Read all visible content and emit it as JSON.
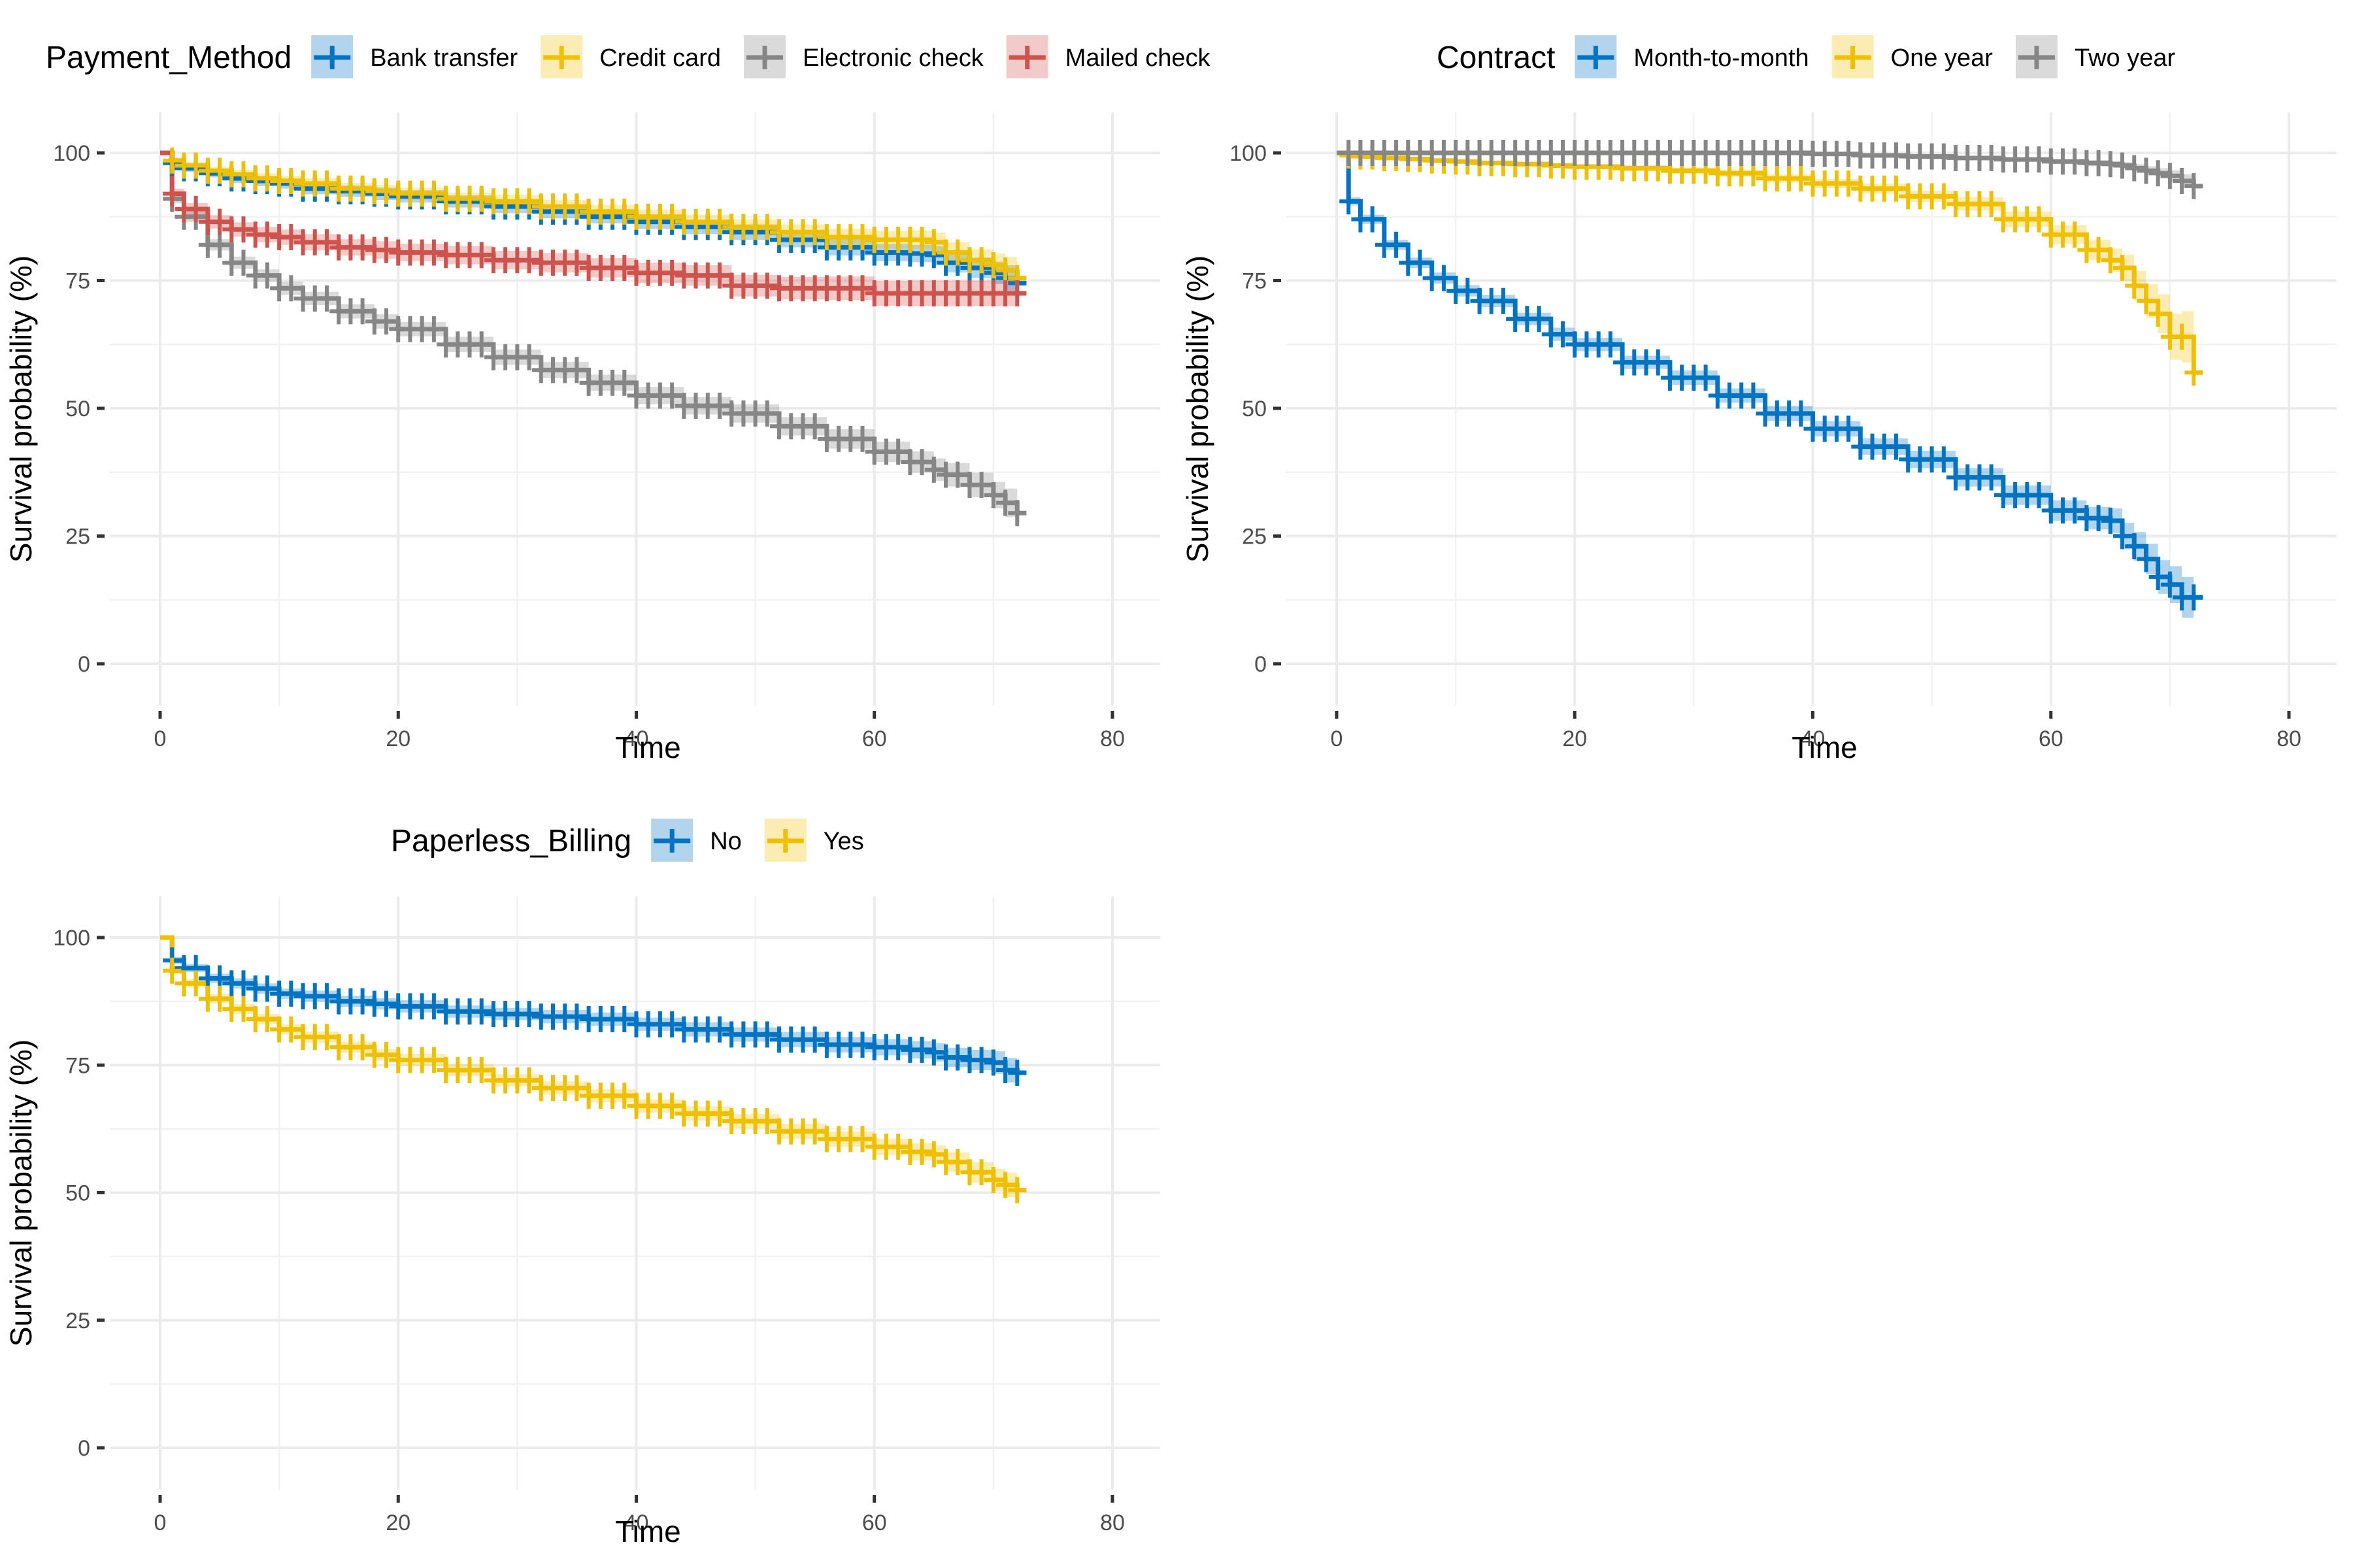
{
  "chart_data": [
    {
      "type": "line",
      "subtype": "kaplan-meier-step",
      "title": "",
      "xlabel": "Time",
      "ylabel": "Survival probability (%)",
      "xlim": [
        0,
        80
      ],
      "ylim": [
        0,
        100
      ],
      "x_ticks": [
        0,
        20,
        40,
        60,
        80
      ],
      "y_ticks": [
        0,
        25,
        50,
        75,
        100
      ],
      "x_tick_labels": [
        "0",
        "20",
        "40",
        "60",
        "80"
      ],
      "y_tick_labels": [
        "0",
        "25",
        "50",
        "75",
        "100"
      ],
      "grid": true,
      "legend_position": "top",
      "legend_title": "Payment_Method",
      "x": [
        0,
        1,
        2,
        4,
        6,
        8,
        10,
        12,
        15,
        18,
        20,
        24,
        28,
        32,
        36,
        40,
        44,
        48,
        52,
        56,
        60,
        63,
        65,
        66,
        68,
        70,
        71,
        72
      ],
      "series": [
        {
          "name": "Bank transfer",
          "color": "#0073C2",
          "values": [
            100,
            98,
            97,
            96,
            95,
            94.5,
            94,
            93,
            92.5,
            92,
            91.5,
            90.5,
            89.5,
            88.5,
            87.5,
            86.5,
            85.5,
            84.5,
            83,
            81.5,
            80.5,
            80.3,
            80,
            78.5,
            77.5,
            76.5,
            75.5,
            74.5
          ],
          "ci_halfwidth": [
            0,
            0.6,
            0.7,
            0.8,
            0.9,
            1.0,
            1.0,
            1.1,
            1.1,
            1.2,
            1.2,
            1.2,
            1.3,
            1.3,
            1.3,
            1.4,
            1.4,
            1.5,
            1.5,
            1.6,
            1.7,
            1.7,
            1.8,
            1.9,
            2.0,
            2.2,
            2.5,
            2.7
          ]
        },
        {
          "name": "Credit card",
          "color": "#EFC000",
          "values": [
            100,
            98.5,
            97.5,
            96.5,
            95.8,
            95,
            94.5,
            94,
            93,
            92.5,
            92,
            91,
            90.5,
            89.5,
            88.5,
            87.5,
            86.5,
            85.5,
            84.5,
            83.5,
            83,
            83,
            82.5,
            80.5,
            79,
            78,
            77,
            75.5
          ],
          "ci_halfwidth": [
            0,
            0.6,
            0.7,
            0.8,
            0.9,
            1.0,
            1.0,
            1.1,
            1.1,
            1.2,
            1.2,
            1.2,
            1.3,
            1.3,
            1.3,
            1.4,
            1.4,
            1.5,
            1.5,
            1.6,
            1.7,
            1.8,
            1.9,
            2.0,
            2.1,
            2.3,
            2.6,
            2.8
          ]
        },
        {
          "name": "Electronic check",
          "color": "#868686",
          "values": [
            100,
            91,
            87.5,
            82,
            78.5,
            76,
            73.5,
            71.5,
            69,
            67,
            65.5,
            62.5,
            60,
            57.5,
            55,
            52.5,
            50.5,
            49,
            46.5,
            44,
            41.5,
            39.5,
            38,
            37,
            35,
            33,
            31.5,
            29.5
          ],
          "ci_halfwidth": [
            0,
            0.9,
            1.0,
            1.1,
            1.2,
            1.2,
            1.3,
            1.3,
            1.4,
            1.4,
            1.4,
            1.5,
            1.5,
            1.6,
            1.6,
            1.7,
            1.7,
            1.8,
            1.8,
            1.9,
            2.0,
            2.1,
            2.2,
            2.3,
            2.4,
            2.6,
            2.8,
            3.0
          ]
        },
        {
          "name": "Mailed check",
          "color": "#CD534C",
          "values": [
            100,
            92,
            89,
            86.5,
            85,
            84,
            83.5,
            82.5,
            81.5,
            81,
            80.5,
            80,
            79,
            78.5,
            77.5,
            76.5,
            76,
            74,
            73.5,
            73.5,
            72.5,
            72.5,
            72.5,
            72.5,
            72.5,
            72.5,
            72.5,
            72.5
          ],
          "ci_halfwidth": [
            0,
            1.0,
            1.2,
            1.3,
            1.4,
            1.5,
            1.5,
            1.6,
            1.6,
            1.7,
            1.7,
            1.8,
            1.8,
            1.9,
            1.9,
            2.0,
            2.0,
            2.1,
            2.2,
            2.3,
            2.4,
            2.5,
            2.5,
            2.5,
            2.5,
            2.5,
            2.5,
            2.5
          ]
        }
      ]
    },
    {
      "type": "line",
      "subtype": "kaplan-meier-step",
      "title": "",
      "xlabel": "Time",
      "ylabel": "Survival probability (%)",
      "xlim": [
        0,
        80
      ],
      "ylim": [
        0,
        100
      ],
      "x_ticks": [
        0,
        20,
        40,
        60,
        80
      ],
      "y_ticks": [
        0,
        25,
        50,
        75,
        100
      ],
      "x_tick_labels": [
        "0",
        "20",
        "40",
        "60",
        "80"
      ],
      "y_tick_labels": [
        "0",
        "25",
        "50",
        "75",
        "100"
      ],
      "grid": true,
      "legend_position": "top",
      "legend_title": "Contract",
      "x": [
        0,
        1,
        2,
        4,
        6,
        8,
        10,
        12,
        15,
        18,
        20,
        24,
        28,
        32,
        36,
        40,
        44,
        48,
        52,
        56,
        60,
        63,
        65,
        66,
        67,
        68,
        69,
        70,
        71,
        72
      ],
      "series": [
        {
          "name": "Month-to-month",
          "color": "#0073C2",
          "values": [
            100,
            90.5,
            87,
            82,
            78.5,
            75.5,
            73,
            71,
            67.5,
            64.5,
            62.5,
            59,
            56,
            52.5,
            49,
            46,
            42.5,
            40,
            36.5,
            33,
            30,
            28.5,
            28,
            25,
            23,
            20.5,
            17,
            15.5,
            13,
            13
          ],
          "ci_halfwidth": [
            0,
            0.8,
            0.9,
            1.0,
            1.0,
            1.1,
            1.1,
            1.2,
            1.2,
            1.3,
            1.3,
            1.3,
            1.4,
            1.4,
            1.5,
            1.5,
            1.6,
            1.7,
            1.8,
            1.9,
            2.0,
            2.2,
            2.4,
            2.6,
            2.8,
            3.0,
            3.3,
            3.6,
            4.0,
            4.5
          ]
        },
        {
          "name": "One year",
          "color": "#EFC000",
          "values": [
            100,
            99.5,
            99.3,
            99,
            98.8,
            98.5,
            98.3,
            98,
            97.8,
            97.5,
            97.3,
            97,
            96.5,
            96,
            95,
            94,
            93,
            91.5,
            90,
            87,
            84,
            81,
            79,
            77.5,
            74,
            71,
            68.5,
            64,
            64,
            57
          ],
          "ci_halfwidth": [
            0,
            0.2,
            0.3,
            0.3,
            0.4,
            0.4,
            0.4,
            0.5,
            0.5,
            0.5,
            0.5,
            0.6,
            0.6,
            0.7,
            0.8,
            0.9,
            1.0,
            1.1,
            1.3,
            1.5,
            1.8,
            2.0,
            2.3,
            2.6,
            2.9,
            3.3,
            3.8,
            4.5,
            5.0,
            5.5
          ]
        },
        {
          "name": "Two year",
          "color": "#868686",
          "values": [
            100,
            100,
            100,
            100,
            100,
            100,
            100,
            100,
            100,
            100,
            100,
            100,
            100,
            100,
            100,
            99.8,
            99.5,
            99.3,
            99,
            98.7,
            98.3,
            98,
            97.8,
            97.5,
            97,
            96.5,
            96,
            95.5,
            94.5,
            93.5
          ],
          "ci_halfwidth": [
            0,
            0,
            0,
            0,
            0,
            0,
            0,
            0,
            0,
            0,
            0,
            0,
            0,
            0,
            0,
            0.2,
            0.3,
            0.3,
            0.4,
            0.4,
            0.5,
            0.6,
            0.6,
            0.7,
            0.8,
            0.9,
            1.0,
            1.1,
            1.3,
            1.5
          ]
        }
      ]
    },
    {
      "type": "line",
      "subtype": "kaplan-meier-step",
      "title": "",
      "xlabel": "Time",
      "ylabel": "Survival probability (%)",
      "xlim": [
        0,
        80
      ],
      "ylim": [
        0,
        100
      ],
      "x_ticks": [
        0,
        20,
        40,
        60,
        80
      ],
      "y_ticks": [
        0,
        25,
        50,
        75,
        100
      ],
      "x_tick_labels": [
        "0",
        "20",
        "40",
        "60",
        "80"
      ],
      "y_tick_labels": [
        "0",
        "25",
        "50",
        "75",
        "100"
      ],
      "grid": true,
      "legend_position": "top",
      "legend_title": "Paperless_Billing",
      "x": [
        0,
        1,
        2,
        4,
        6,
        8,
        10,
        12,
        15,
        18,
        20,
        24,
        28,
        32,
        36,
        40,
        44,
        48,
        52,
        56,
        60,
        63,
        65,
        66,
        68,
        70,
        71,
        72
      ],
      "series": [
        {
          "name": "No",
          "color": "#0073C2",
          "values": [
            100,
            95.5,
            94,
            92,
            91,
            90,
            89,
            88.5,
            87.5,
            87,
            86.5,
            85.5,
            85,
            84.5,
            84,
            83,
            82,
            81,
            80,
            79,
            78.5,
            78,
            77.5,
            76.5,
            76,
            75.5,
            74,
            73.5
          ],
          "ci_halfwidth": [
            0,
            0.7,
            0.8,
            0.9,
            1.0,
            1.0,
            1.0,
            1.1,
            1.1,
            1.1,
            1.2,
            1.2,
            1.2,
            1.3,
            1.3,
            1.3,
            1.4,
            1.4,
            1.5,
            1.5,
            1.6,
            1.7,
            1.8,
            1.9,
            2.0,
            2.2,
            2.4,
            2.6
          ]
        },
        {
          "name": "Yes",
          "color": "#EFC000",
          "values": [
            100,
            93.5,
            91,
            88,
            86,
            84,
            82,
            80.5,
            78.5,
            77,
            76,
            74,
            72,
            70.5,
            69,
            67,
            65.5,
            64,
            62,
            60.5,
            59,
            58,
            57.5,
            56,
            54,
            52.5,
            51.5,
            50.5
          ],
          "ci_halfwidth": [
            0,
            0.7,
            0.8,
            0.9,
            1.0,
            1.0,
            1.0,
            1.1,
            1.1,
            1.1,
            1.2,
            1.2,
            1.2,
            1.3,
            1.3,
            1.3,
            1.4,
            1.4,
            1.5,
            1.5,
            1.6,
            1.7,
            1.8,
            1.9,
            2.0,
            2.2,
            2.4,
            2.6
          ]
        }
      ]
    }
  ]
}
